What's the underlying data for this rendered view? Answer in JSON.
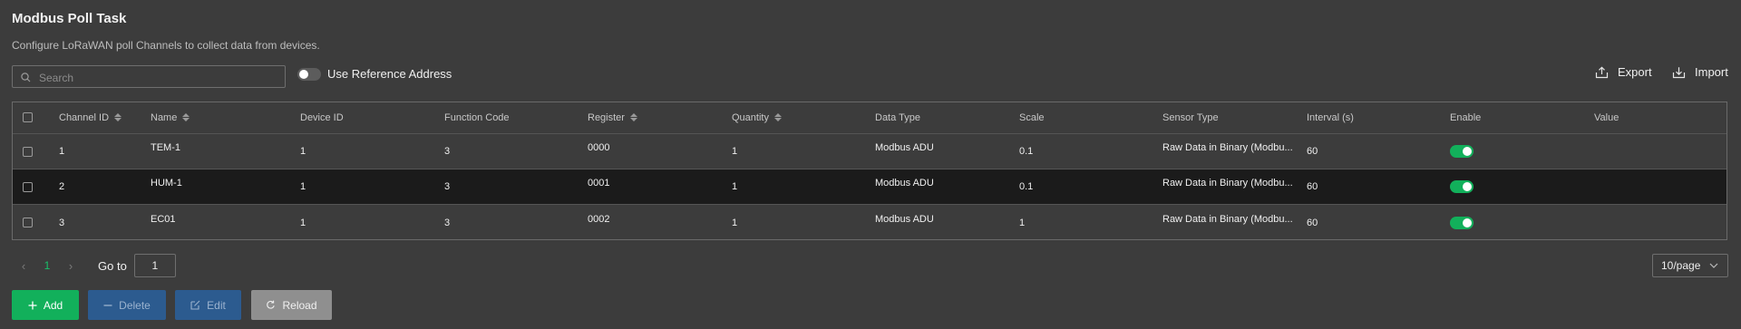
{
  "page": {
    "title": "Modbus Poll Task",
    "subtitle": "Configure LoRaWAN poll Channels to collect data from devices."
  },
  "toolbar": {
    "search_placeholder": "Search",
    "reference_toggle_label": "Use Reference Address",
    "reference_toggle_on": false,
    "export_label": "Export",
    "import_label": "Import"
  },
  "table": {
    "columns": {
      "channel_id": "Channel ID",
      "name": "Name",
      "device_id": "Device ID",
      "function_code": "Function Code",
      "register": "Register",
      "quantity": "Quantity",
      "data_type": "Data Type",
      "scale": "Scale",
      "sensor_type": "Sensor Type",
      "interval": "Interval (s)",
      "enable": "Enable",
      "value": "Value"
    },
    "rows": [
      {
        "channel_id": "1",
        "name": "TEM-1",
        "device_id": "1",
        "function_code": "3",
        "register": "0000",
        "quantity": "1",
        "data_type": "Modbus ADU",
        "scale": "0.1",
        "sensor_type": "Raw Data in Binary (Modbu...",
        "interval": "60",
        "enabled": true,
        "value": ""
      },
      {
        "channel_id": "2",
        "name": "HUM-1",
        "device_id": "1",
        "function_code": "3",
        "register": "0001",
        "quantity": "1",
        "data_type": "Modbus ADU",
        "scale": "0.1",
        "sensor_type": "Raw Data in Binary (Modbu...",
        "interval": "60",
        "enabled": true,
        "value": ""
      },
      {
        "channel_id": "3",
        "name": "EC01",
        "device_id": "1",
        "function_code": "3",
        "register": "0002",
        "quantity": "1",
        "data_type": "Modbus ADU",
        "scale": "1",
        "sensor_type": "Raw Data in Binary (Modbu...",
        "interval": "60",
        "enabled": true,
        "value": ""
      }
    ]
  },
  "pagination": {
    "current_page": "1",
    "goto_label": "Go to",
    "goto_value": "1",
    "page_size": "10/page"
  },
  "actions": {
    "add_label": "Add",
    "delete_label": "Delete",
    "edit_label": "Edit",
    "reload_label": "Reload"
  },
  "colors": {
    "background": "#3c3c3c",
    "accent_green": "#12b05b",
    "secondary_blue": "#2c5b8f",
    "selected_row": "#1b1b1b"
  }
}
